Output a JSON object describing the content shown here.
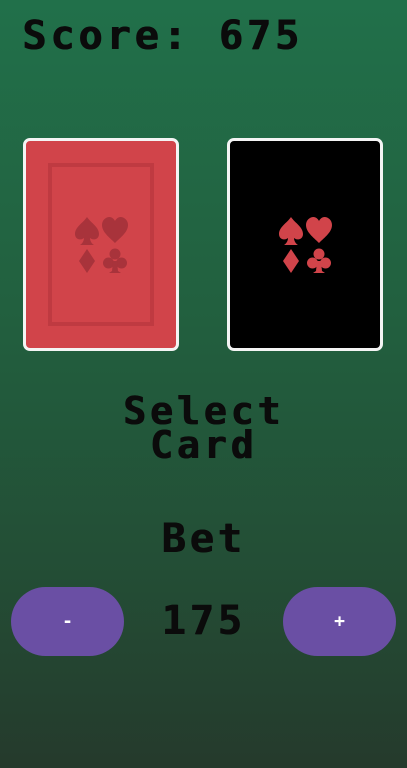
{
  "score_text": "Score: 675",
  "cards": [
    {
      "id": "left",
      "style": "red-back",
      "color": "#d1444a",
      "suit_color": "#a8333b"
    },
    {
      "id": "right",
      "style": "black-back",
      "color": "#000000",
      "suit_color": "#d1444a"
    }
  ],
  "prompt_text": "Select\nCard",
  "bet_label": "Bet",
  "bet_amount": "175",
  "buttons": {
    "minus_label": "-",
    "plus_label": "+"
  },
  "colors": {
    "button": "#6a4fa4",
    "background_top": "#21704a",
    "background_bottom": "#253a2c"
  }
}
